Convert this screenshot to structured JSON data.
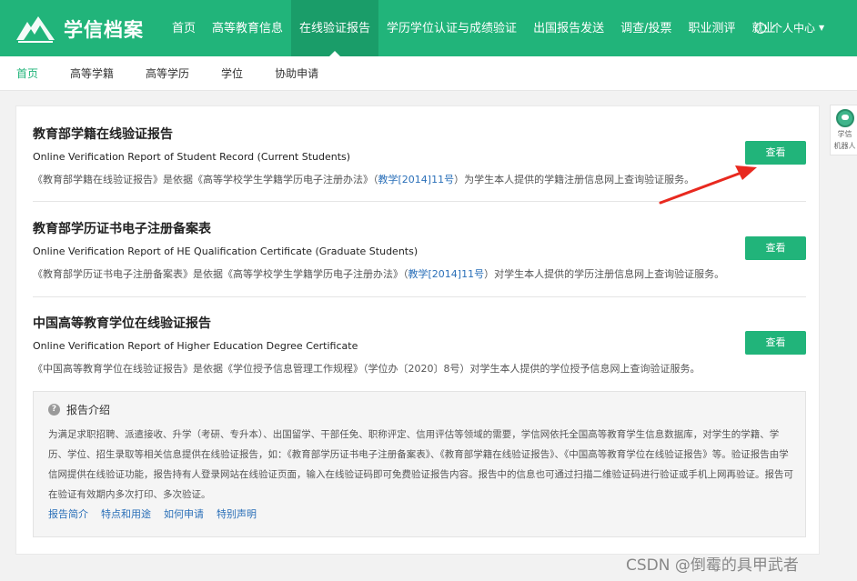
{
  "header": {
    "logo_text": "学信档案",
    "nav": [
      {
        "label": "首页"
      },
      {
        "label": "高等教育信息"
      },
      {
        "label": "在线验证报告"
      },
      {
        "label": "学历学位认证与成绩验证"
      },
      {
        "label": "出国报告发送"
      },
      {
        "label": "调查/投票"
      },
      {
        "label": "职业测评"
      },
      {
        "label": "就业"
      }
    ],
    "active_nav": "在线验证报告",
    "user_center": "个人中心"
  },
  "subnav": {
    "items": [
      {
        "label": "首页"
      },
      {
        "label": "高等学籍"
      },
      {
        "label": "高等学历"
      },
      {
        "label": "学位"
      },
      {
        "label": "协助申请"
      }
    ],
    "active": "首页"
  },
  "reports": [
    {
      "title": "教育部学籍在线验证报告",
      "en": "Online Verification Report of Student Record (Current Students)",
      "desc_pre": "《教育部学籍在线验证报告》是依据《高等学校学生学籍学历电子注册办法》（",
      "desc_link": "教学[2014]11号",
      "desc_post": "）为学生本人提供的学籍注册信息网上查询验证服务。",
      "button": "查看"
    },
    {
      "title": "教育部学历证书电子注册备案表",
      "en": "Online Verification Report of HE Qualification Certificate (Graduate Students)",
      "desc_pre": "《教育部学历证书电子注册备案表》是依据《高等学校学生学籍学历电子注册办法》（",
      "desc_link": "教学[2014]11号",
      "desc_post": "）对学生本人提供的学历注册信息网上查询验证服务。",
      "button": "查看"
    },
    {
      "title": "中国高等教育学位在线验证报告",
      "en": "Online Verification Report of Higher Education Degree Certificate",
      "desc_pre": "《中国高等教育学位在线验证报告》是依据《学位授予信息管理工作规程》（学位办〔2020〕8号）对学生本人提供的学位授予信息网上查询验证服务。",
      "desc_link": "",
      "desc_post": "",
      "button": "查看"
    }
  ],
  "intro": {
    "title": "报告介绍",
    "body": "为满足求职招聘、派遣接收、升学（考研、专升本）、出国留学、干部任免、职称评定、信用评估等领域的需要，学信网依托全国高等教育学生信息数据库，对学生的学籍、学历、学位、招生录取等相关信息提供在线验证报告，如：《教育部学历证书电子注册备案表》、《教育部学籍在线验证报告》、《中国高等教育学位在线验证报告》等。验证报告由学信网提供在线验证功能，报告持有人登录网站在线验证页面，输入在线验证码即可免费验证报告内容。报告中的信息也可通过扫描二维验证码进行验证或手机上网再验证。报告可在验证有效期内多次打印、多次验证。",
    "links": [
      "报告简介",
      "特点和用途",
      "如何申请",
      "特别声明"
    ]
  },
  "float_widget": {
    "line1": "学信",
    "line2": "机器人"
  },
  "watermark": "CSDN @倒霉的具甲武者",
  "colors": {
    "brand": "#21b47a",
    "brand_dark": "#1a9d69",
    "link": "#2a6fb8",
    "arrow": "#e8291f"
  }
}
